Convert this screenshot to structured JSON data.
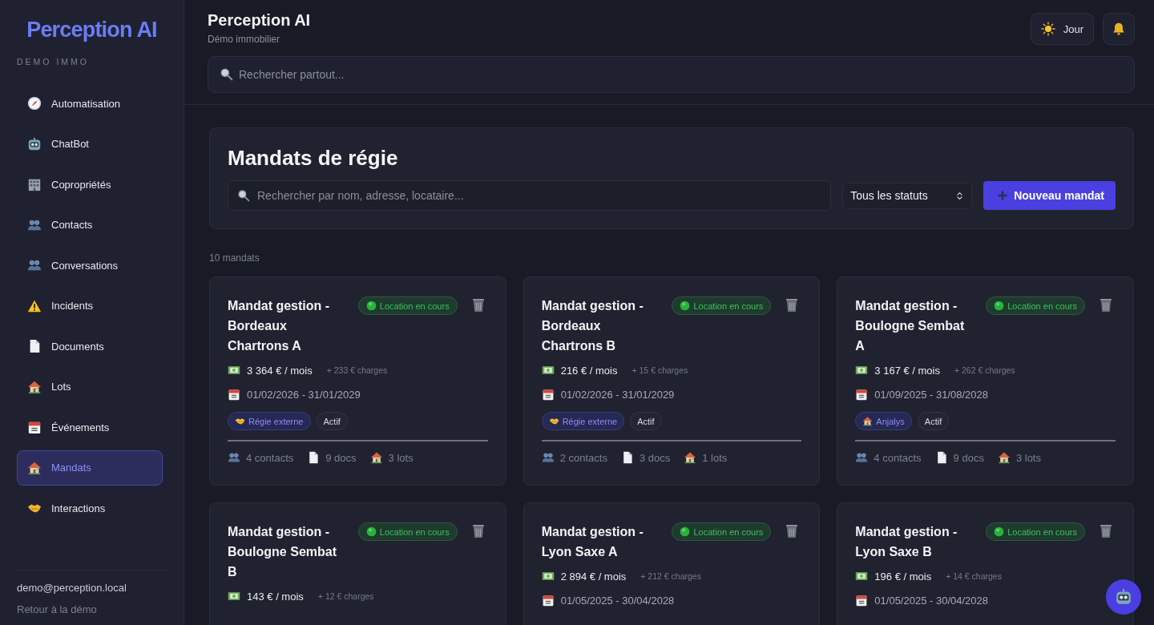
{
  "sidebar": {
    "logo": "Perception AI",
    "subtitle": "DEMO IMMO",
    "items": [
      {
        "label": "Automatisation",
        "selected": false
      },
      {
        "label": "ChatBot",
        "selected": false
      },
      {
        "label": "Copropriétés",
        "selected": false
      },
      {
        "label": "Contacts",
        "selected": false
      },
      {
        "label": "Conversations",
        "selected": false
      },
      {
        "label": "Incidents",
        "selected": false
      },
      {
        "label": "Documents",
        "selected": false
      },
      {
        "label": "Lots",
        "selected": false
      },
      {
        "label": "Événements",
        "selected": false
      },
      {
        "label": "Mandats",
        "selected": true
      },
      {
        "label": "Interactions",
        "selected": false
      }
    ],
    "user_email": "demo@perception.local",
    "back_link": "Retour à la démo"
  },
  "header": {
    "title": "Perception AI",
    "subtitle": "Démo immobilier",
    "theme_button": "Jour",
    "search": {
      "placeholder": "Rechercher partout..."
    }
  },
  "panel": {
    "title": "Mandats de régie",
    "search": {
      "placeholder": "Rechercher par nom, adresse, locataire..."
    },
    "status_filter": "Tous les statuts",
    "new_button": "Nouveau mandat"
  },
  "count": "10 mandats",
  "cards": [
    {
      "title": "Mandat gestion - Bordeaux Chartrons A",
      "status": "Location en cours",
      "rent": "3 364 € / mois",
      "charges": "+ 233 € charges",
      "dates": "01/02/2026 - 31/01/2029",
      "tags": [
        {
          "kind": "regie",
          "label": "Régie externe"
        },
        {
          "kind": "state",
          "label": "Actif"
        }
      ],
      "stats": {
        "contacts": "4 contacts",
        "docs": "9 docs",
        "lots": "3 lots"
      }
    },
    {
      "title": "Mandat gestion - Bordeaux Chartrons B",
      "status": "Location en cours",
      "rent": "216 € / mois",
      "charges": "+ 15 € charges",
      "dates": "01/02/2026 - 31/01/2029",
      "tags": [
        {
          "kind": "regie",
          "label": "Régie externe"
        },
        {
          "kind": "state",
          "label": "Actif"
        }
      ],
      "stats": {
        "contacts": "2 contacts",
        "docs": "3 docs",
        "lots": "1 lots"
      }
    },
    {
      "title": "Mandat gestion - Boulogne Sembat A",
      "status": "Location en cours",
      "rent": "3 167 € / mois",
      "charges": "+ 262 € charges",
      "dates": "01/09/2025 - 31/08/2028",
      "tags": [
        {
          "kind": "agency",
          "label": "Anjalys"
        },
        {
          "kind": "state",
          "label": "Actif"
        }
      ],
      "stats": {
        "contacts": "4 contacts",
        "docs": "9 docs",
        "lots": "3 lots"
      }
    },
    {
      "title": "Mandat gestion - Boulogne Sembat B",
      "status": "Location en cours",
      "rent": "143 € / mois",
      "charges": "+ 12 € charges"
    },
    {
      "title": "Mandat gestion - Lyon Saxe A",
      "status": "Location en cours",
      "rent": "2 894 € / mois",
      "charges": "+ 212 € charges",
      "dates": "01/05/2025 - 30/04/2028"
    },
    {
      "title": "Mandat gestion - Lyon Saxe B",
      "status": "Location en cours",
      "rent": "196 € / mois",
      "charges": "+ 14 € charges",
      "dates": "01/05/2025 - 30/04/2028"
    }
  ]
}
